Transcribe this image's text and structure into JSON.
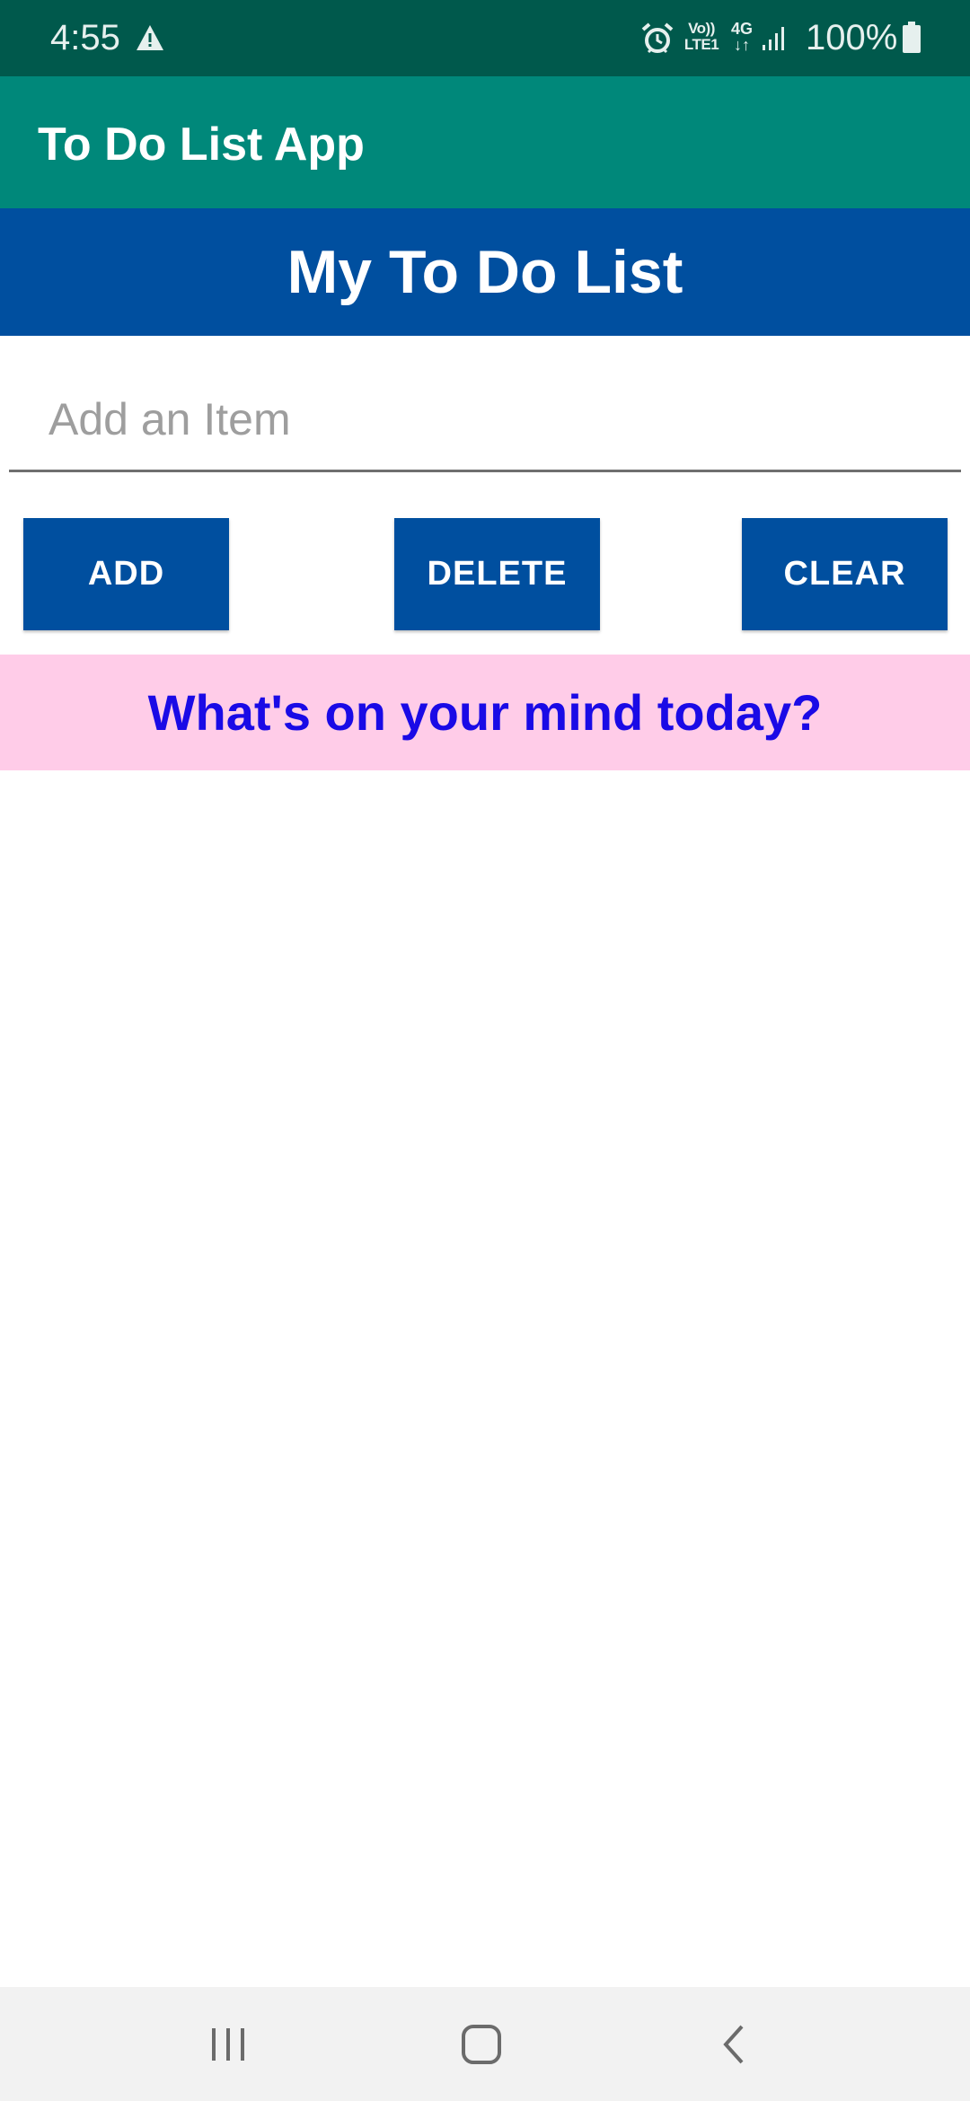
{
  "status_bar": {
    "time": "4:55",
    "volte_line1": "Vo))",
    "volte_line2": "LTE1",
    "network_type": "4G",
    "network_arrows": "↓↑",
    "battery_percent": "100%",
    "icons": [
      "warning-icon",
      "alarm-icon",
      "signal-icon",
      "battery-icon"
    ]
  },
  "app_bar": {
    "title": "To Do List App",
    "color": "#00887A"
  },
  "header": {
    "title": "My To Do List",
    "color": "#004F9F"
  },
  "input": {
    "value": "",
    "placeholder": "Add an Item"
  },
  "buttons": {
    "add": "ADD",
    "delete": "DELETE",
    "clear": "CLEAR",
    "color": "#004F9F"
  },
  "prompt": {
    "text": "What's on your mind today?",
    "background": "#FFCCE8",
    "color": "#1A0AE6"
  },
  "items": [],
  "nav_bar": {
    "icons": [
      "recents-icon",
      "home-icon",
      "back-icon"
    ]
  }
}
